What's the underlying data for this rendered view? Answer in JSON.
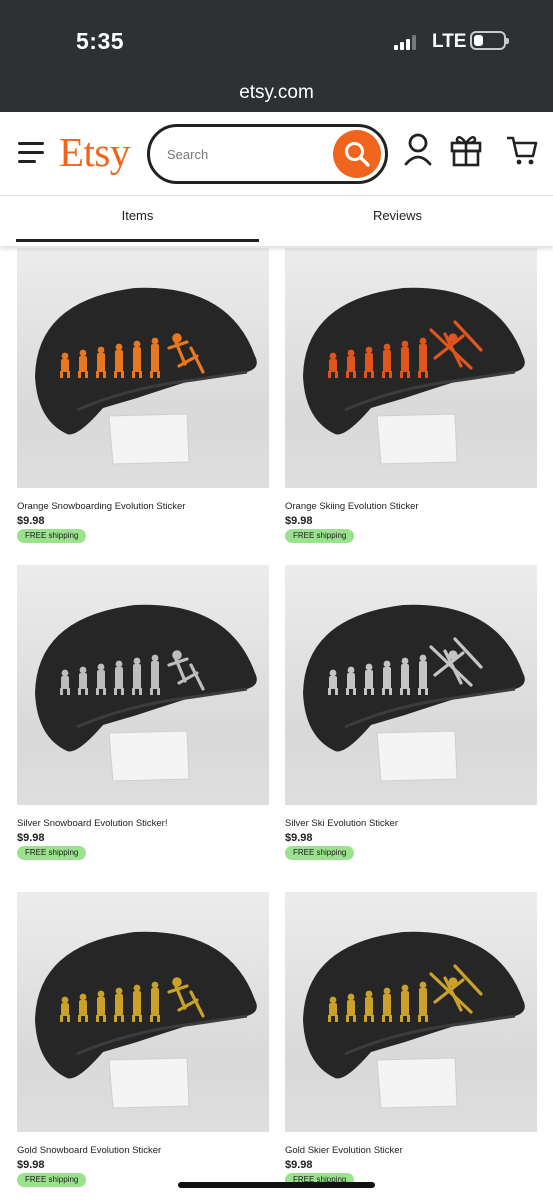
{
  "status_bar": {
    "time": "5:35",
    "network": "LTE"
  },
  "browser": {
    "url": "etsy.com"
  },
  "header": {
    "logo": "Etsy",
    "search_placeholder": "Search",
    "icons": [
      "menu-icon",
      "search-icon",
      "account-icon",
      "gift-icon",
      "cart-icon"
    ]
  },
  "tabs": [
    {
      "label": "Items",
      "selected": true
    },
    {
      "label": "Reviews",
      "selected": false
    }
  ],
  "products": [
    {
      "title": "Orange Snowboarding Evolution Sticker",
      "price": "$9.98",
      "badge": "FREE shipping",
      "sticker_color": "#e8771e",
      "figure": "snowboarder"
    },
    {
      "title": "Orange Skiing Evolution Sticker",
      "price": "$9.98",
      "badge": "FREE shipping",
      "sticker_color": "#e0551e",
      "figure": "skier"
    },
    {
      "title": "Silver Snowboard Evolution Sticker!",
      "price": "$9.98",
      "badge": "FREE shipping",
      "sticker_color": "#bdbdbd",
      "figure": "snowboarder"
    },
    {
      "title": "Silver Ski Evolution Sticker",
      "price": "$9.98",
      "badge": "FREE shipping",
      "sticker_color": "#c4c4c4",
      "figure": "skier"
    },
    {
      "title": "Gold Snowboard Evolution Sticker",
      "price": "$9.98",
      "badge": "FREE shipping",
      "sticker_color": "#c9a227",
      "figure": "snowboarder"
    },
    {
      "title": "Gold Skier Evolution Sticker",
      "price": "$9.98",
      "badge": "FREE shipping",
      "sticker_color": "#caa12b",
      "figure": "skier"
    }
  ],
  "colors": {
    "brand": "#f1641e",
    "badge_bg": "#9be28f",
    "chrome": "#2e3134"
  }
}
